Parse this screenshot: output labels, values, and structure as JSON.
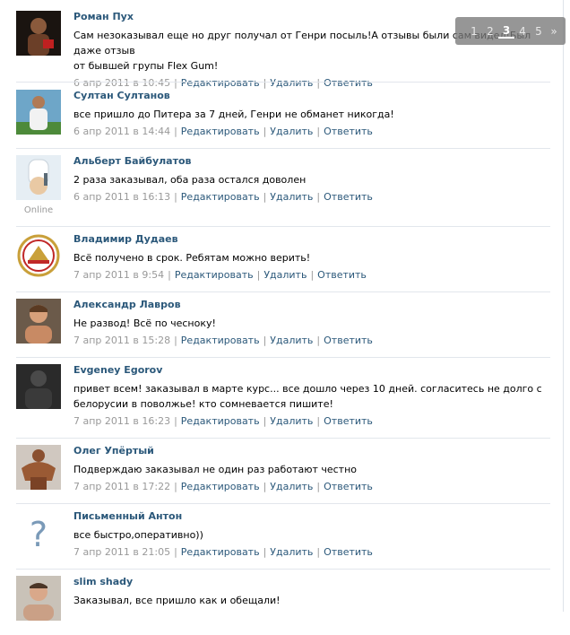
{
  "pager": {
    "pages": [
      "1",
      "2",
      "3",
      "4",
      "5"
    ],
    "current": "3",
    "next": "»"
  },
  "comments": [
    {
      "author": "Роман Пух",
      "text": [
        "Сам незоказывал еще но друг получал от Генри посыль!А отзывы были сам видел!Был даже отзыв",
        "от бывшей групы Flex Gum!"
      ],
      "date": "6 апр 2011 в 10:45",
      "online": ""
    },
    {
      "author": "Султан Султанов",
      "text": [
        "все пришло до Питера за 7 дней, Генри не обманет никогда!"
      ],
      "date": "6 апр 2011 в 14:44",
      "online": ""
    },
    {
      "author": "Альберт Байбулатов",
      "text": [
        "2 раза заказывал, оба раза остался доволен"
      ],
      "date": "6 апр 2011 в 16:13",
      "online": "Online"
    },
    {
      "author": "Владимир Дудаев",
      "text": [
        "Всё получено в срок. Ребятам можно верить!"
      ],
      "date": "7 апр 2011 в 9:54",
      "online": ""
    },
    {
      "author": "Александр Лавров",
      "text": [
        "Не развод! Всё по чесноку!"
      ],
      "date": "7 апр 2011 в 15:28",
      "online": ""
    },
    {
      "author": "Evgeney Egorov",
      "text": [
        "привет всем! заказывал в марте курс... все дошло через 10 дней. согласитесь не долго с",
        "белорусии в поволжье! кто сомневается пишите!"
      ],
      "date": "7 апр 2011 в 16:23",
      "online": ""
    },
    {
      "author": "Олег Упёртый",
      "text": [
        "Подверждаю заказывал не один раз работают честно"
      ],
      "date": "7 апр 2011 в 17:22",
      "online": ""
    },
    {
      "author": "Письменный Антон",
      "text": [
        "все быстро,оперативно))"
      ],
      "date": "7 апр 2011 в 21:05",
      "online": ""
    },
    {
      "author": "slim shady",
      "text": [
        "Заказывал, все пришло как и обещали!"
      ],
      "date": "",
      "online": ""
    }
  ],
  "actions": {
    "edit": "Редактировать",
    "delete": "Удалить",
    "reply": "Ответить"
  }
}
